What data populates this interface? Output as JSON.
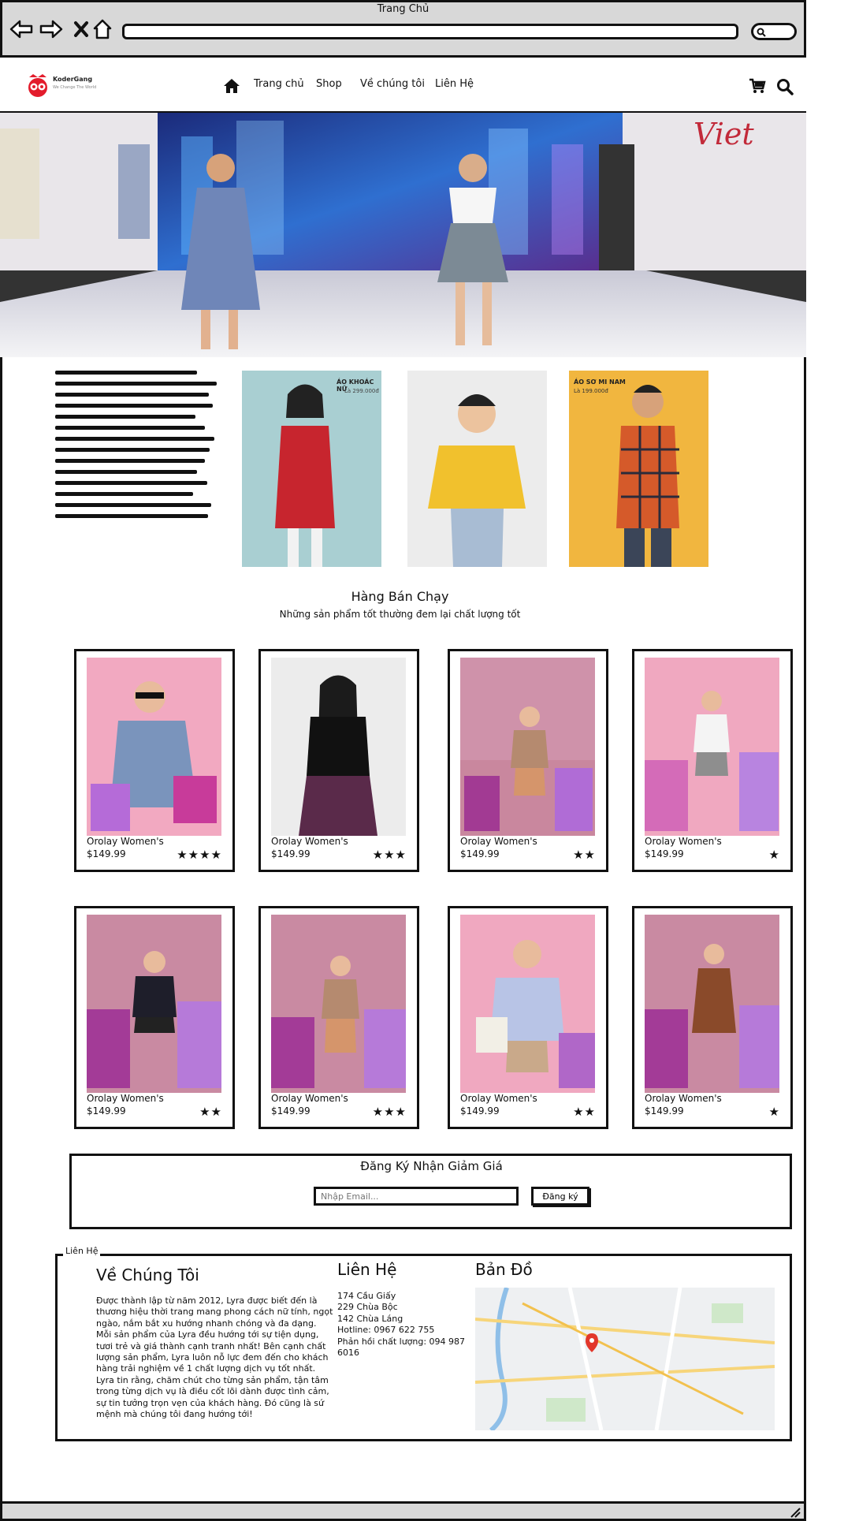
{
  "browser": {
    "title": "Trang Chủ"
  },
  "logo": {
    "name": "KoderGang",
    "tagline": "We Change The World"
  },
  "nav": {
    "items": [
      "Trang chủ",
      "Shop",
      "Về chúng tôi",
      "Liên Hệ"
    ]
  },
  "best_sellers": {
    "title": "Hàng Bán Chạy",
    "subtitle": "Những sản phẩm tốt thường đem lại chất lượng tốt",
    "products": [
      {
        "name": "Orolay Women's",
        "price": "$149.99",
        "stars": "★★★★"
      },
      {
        "name": "Orolay Women's",
        "price": "$149.99",
        "stars": "★★★"
      },
      {
        "name": "Orolay Women's",
        "price": "$149.99",
        "stars": "★★"
      },
      {
        "name": "Orolay Women's",
        "price": "$149.99",
        "stars": "★"
      },
      {
        "name": "Orolay Women's",
        "price": "$149.99",
        "stars": "★★"
      },
      {
        "name": "Orolay Women's",
        "price": "$149.99",
        "stars": "★★★"
      },
      {
        "name": "Orolay Women's",
        "price": "$149.99",
        "stars": "★★"
      },
      {
        "name": "Orolay Women's",
        "price": "$149.99",
        "stars": "★"
      }
    ]
  },
  "features": {
    "jacket_label": "ÁO KHOÁC NỮ",
    "jacket_price": "Là 299.000đ",
    "shirt_label": "ÁO SƠ MI NAM",
    "shirt_price": "Là 199.000đ"
  },
  "newsletter": {
    "title": "Đăng Ký Nhận Giảm Giá",
    "placeholder": "Nhập Email...",
    "button": "Đăng ký"
  },
  "contact": {
    "legend": "Liên Hệ",
    "about_title": "Về Chúng Tôi",
    "about_text": "Được thành lập từ năm 2012, Lyra được biết đến là thương hiệu thời trang mang phong cách nữ tính, ngọt ngào, nắm bắt xu hướng nhanh chóng và đa dạng. Mỗi sản phẩm của Lyra đều hướng tới sự tiện dụng, tươi trẻ và giá thành cạnh tranh nhất! Bên cạnh chất lượng sản phẩm, Lyra luôn nỗ lực đem đến cho khách hàng trải nghiệm về 1 chất lượng dịch vụ tốt nhất. Lyra tin rằng, chăm chút cho từng sản phẩm, tận tâm trong từng dịch vụ là điều cốt lõi dành được tình cảm, sự tin tưởng trọn vẹn của khách hàng. Đó cũng là sứ mệnh mà chúng tôi đang hướng tới!",
    "contact_title": "Liên Hệ",
    "lines": [
      "174 Cầu Giấy",
      "229 Chùa Bộc",
      "142 Chùa Láng",
      "Hotline:  0967 622 755",
      "Phản hồi chất lượng: 094 987 6016"
    ],
    "map_title": "Bản Đồ"
  },
  "colors": {
    "frame": "#111111",
    "chrome": "#d8d8d8",
    "accent": "#e31c2c",
    "banner": "#f1b63f"
  }
}
